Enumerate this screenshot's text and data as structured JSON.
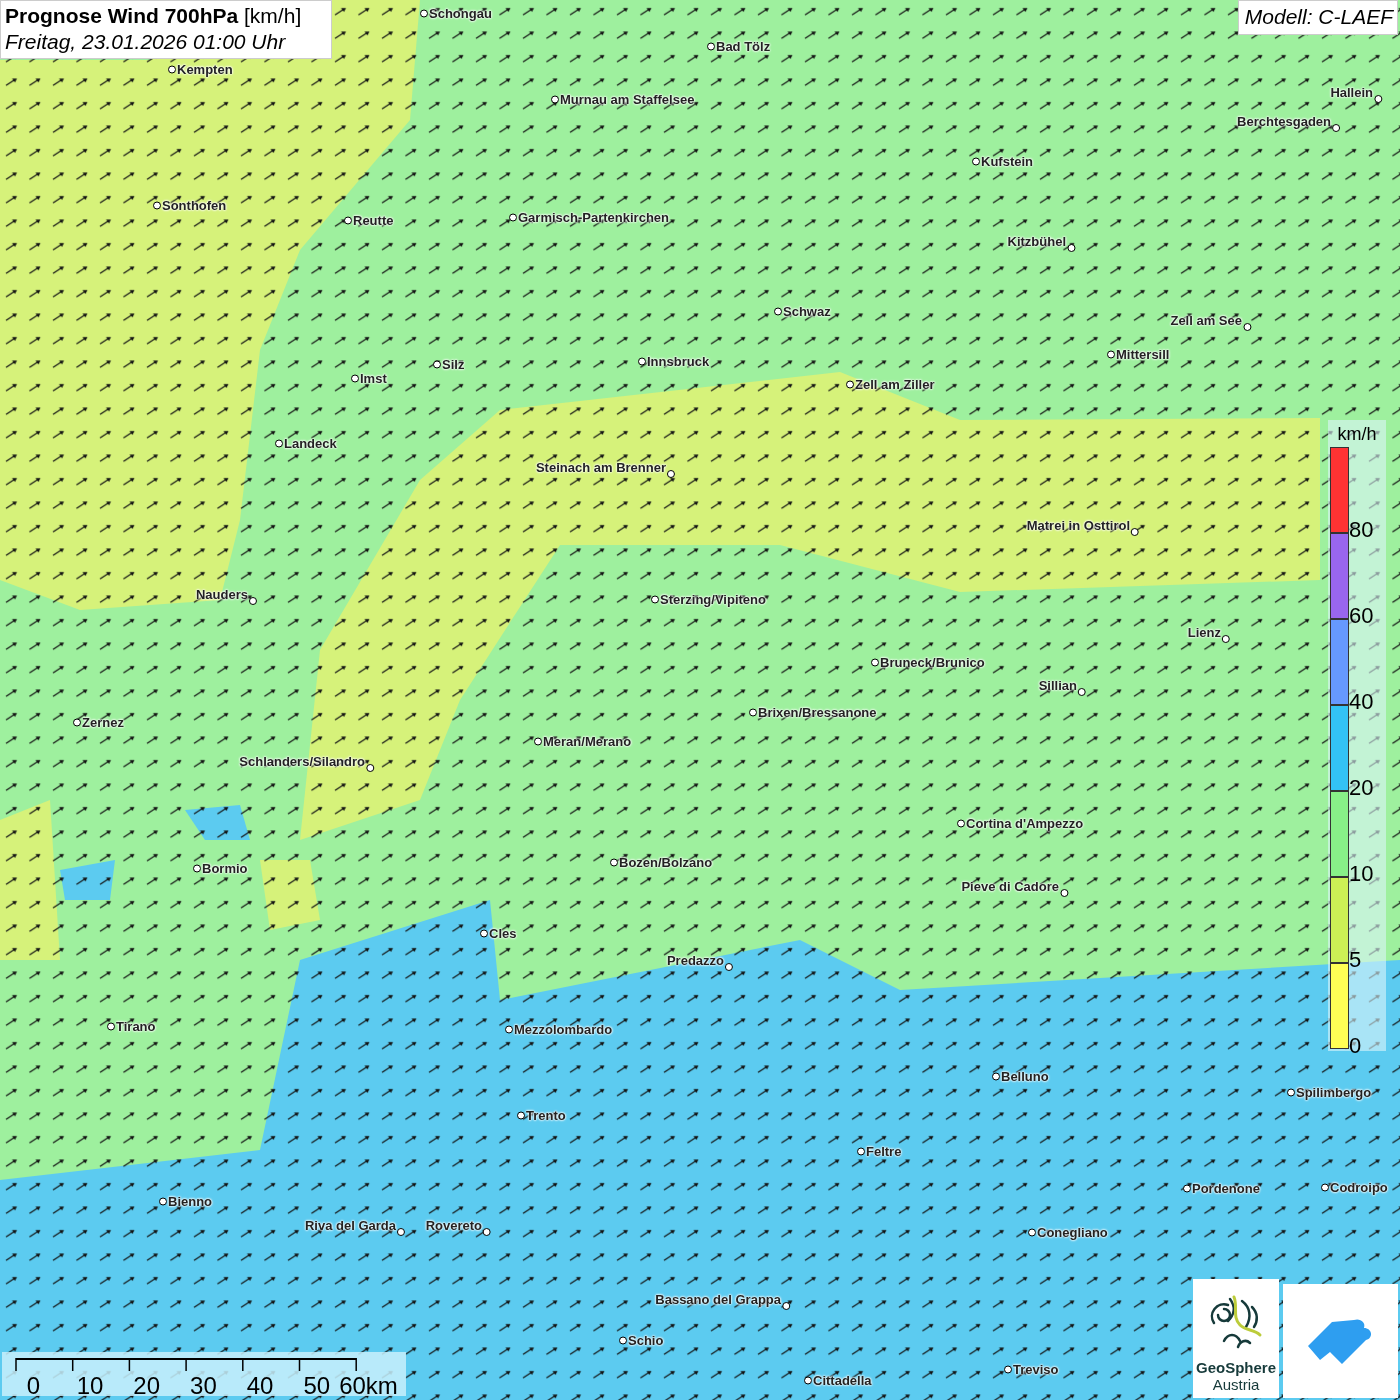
{
  "title": {
    "heading": "**Prognose Wind 700hPa** [km/h]",
    "subtitle": "Freitag, 23.01.2026 01:00 Uhr"
  },
  "model": "Modell: C-LAEF",
  "cities": [
    "Schongau",
    "Bad Tölz",
    "Kempten",
    "Murnau am Staffelsee",
    "Hallein",
    "Berchtesgaden",
    "Kufstein",
    "Sonthofen",
    "Reutte",
    "Garmisch-Partenkirchen",
    "Kitzbühel",
    "Schwaz",
    "Zell am See",
    "Mittersill",
    "Innsbruck",
    "Silz",
    "Imst",
    "Zell am Ziller",
    "Landeck",
    "Steinach am Brenner",
    "Matrei in Osttirol",
    "Nauders",
    "Sterzing/Vipiteno",
    "Lienz",
    "Bruneck/Brunico",
    "Sillian",
    "Brixen/Bressanone",
    "Zernez",
    "Meran/Merano",
    "Schlanders/Silandro",
    "Cortina d'Ampezzo",
    "Bozen/Bolzano",
    "Bormio",
    "Pieve di Cadore",
    "Cles",
    "Predazzo",
    "Tirano",
    "Mezzolombardo",
    "Belluno",
    "Spilimbergo",
    "Trento",
    "Feltre",
    "Pordenone",
    "Codroipo",
    "Bienno",
    "Riva del Garda",
    "Rovereto",
    "Conegliano",
    "Bassano del Grappa",
    "Schio",
    "Treviso",
    "Cittadella"
  ],
  "legend": {
    "unit": "km/h",
    "steps": [
      {
        "label": "80",
        "color": "#ff3333"
      },
      {
        "label": "60",
        "color": "#9966ee"
      },
      {
        "label": "40",
        "color": "#6699ff"
      },
      {
        "label": "20",
        "color": "#33c3f5"
      },
      {
        "label": "10",
        "color": "#88f088"
      },
      {
        "label": "5",
        "color": "#ccf055"
      },
      {
        "label": "0",
        "color": "#ffff55"
      }
    ]
  },
  "scale_bar": [
    "0",
    "10",
    "20",
    "30",
    "40",
    "50",
    "60km"
  ],
  "logo": {
    "name": "GeoSphere",
    "subname": "Austria"
  }
}
